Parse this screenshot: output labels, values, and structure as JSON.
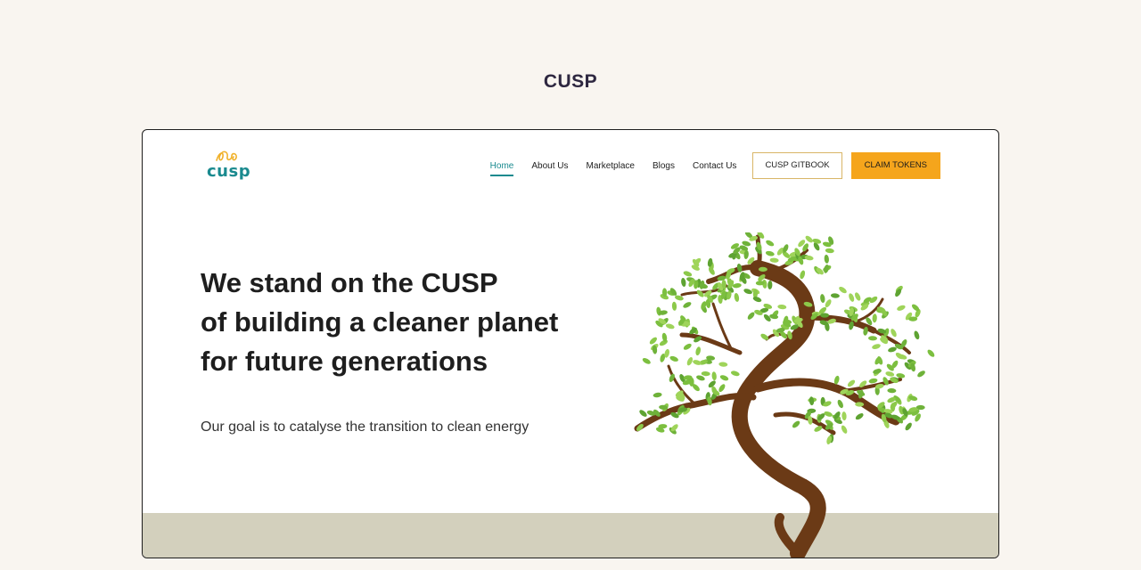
{
  "page": {
    "title": "CUSP"
  },
  "site": {
    "logo": {
      "text": "cusp",
      "icon": "logo-scribble-icon"
    },
    "nav": [
      {
        "label": "Home",
        "active": true
      },
      {
        "label": "About Us",
        "active": false
      },
      {
        "label": "Marketplace",
        "active": false
      },
      {
        "label": "Blogs",
        "active": false
      },
      {
        "label": "Contact Us",
        "active": false
      }
    ],
    "gitbook_button": "CUSP GITBOOK",
    "claim_button": "CLAIM TOKENS"
  },
  "hero": {
    "heading_lines": [
      "We stand on the CUSP",
      "of building a cleaner planet",
      "for future generations"
    ],
    "subheading": "Our goal is to catalyse the transition to clean energy",
    "illustration": "tree-illustration"
  },
  "colors": {
    "background": "#f9f5f0",
    "accent_teal": "#1a8a8f",
    "accent_orange": "#f5a51c",
    "ground": "#d3d0bd",
    "tree_trunk": "#6b3a16",
    "leaf_green": "#7cbf3f"
  }
}
